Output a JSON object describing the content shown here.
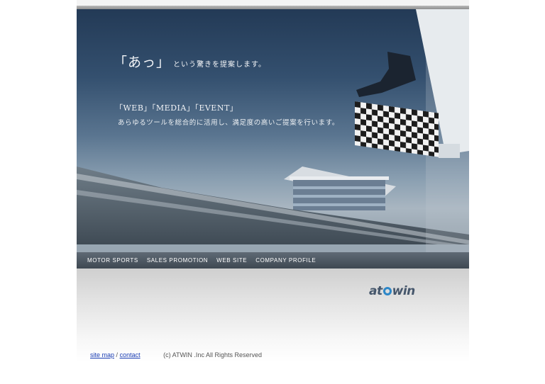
{
  "hero": {
    "tagline_main": "「あっ」",
    "tagline_sub": "という驚きを提案します。",
    "services": "「WEB」「MEDIA」「EVENT」",
    "description": "あらゆるツールを総合的に活用し、満足度の高いご提案を行います。"
  },
  "nav": {
    "items": [
      {
        "label": "MOTOR SPORTS"
      },
      {
        "label": "SALES PROMOTION"
      },
      {
        "label": "WEB SITE"
      },
      {
        "label": "COMPANY PROFILE"
      }
    ]
  },
  "logo": {
    "part1": "at",
    "part2": "win",
    "ring_color": "#2d87c8"
  },
  "footer": {
    "site_map": "site map",
    "separator": "/",
    "contact": "contact",
    "copyright": "(c) ATWIN .Inc All Rights Reserved"
  }
}
